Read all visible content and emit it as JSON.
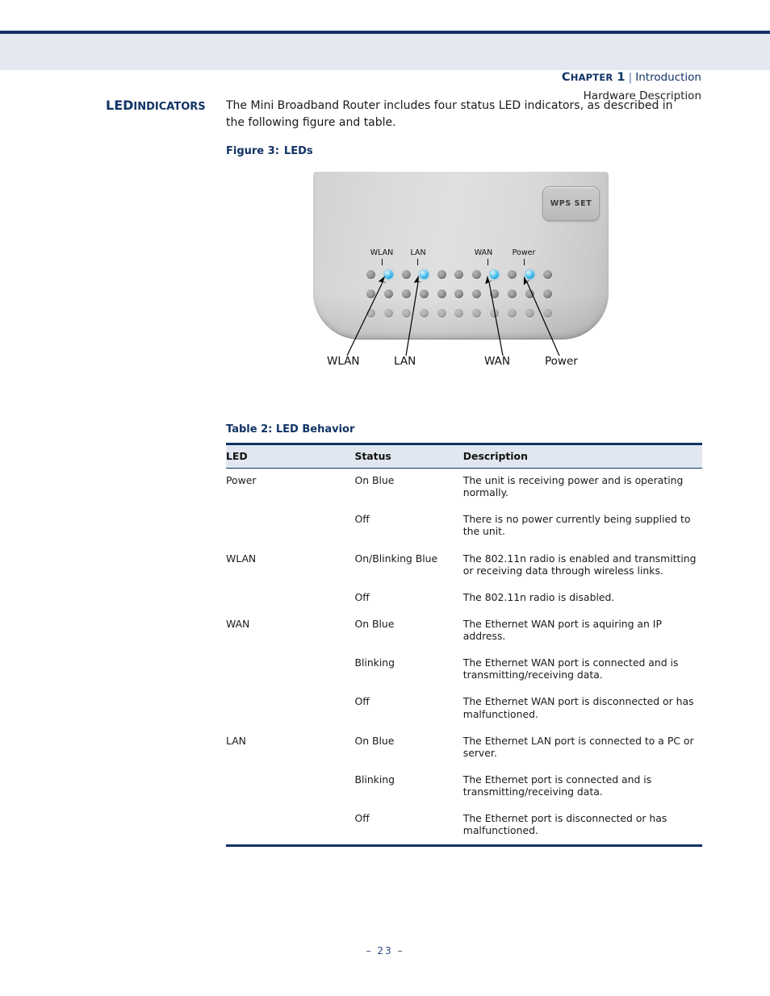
{
  "header": {
    "chapter_label_cap": "C",
    "chapter_label_rest": "HAPTER",
    "chapter_number": "1",
    "separator": "|",
    "chapter_title": "Introduction",
    "subtitle": "Hardware Description",
    "rule_color": "#113366",
    "band_color": "#e4e8f1"
  },
  "section": {
    "heading_big": "LED",
    "heading_small": "INDICATORS",
    "body": "The Mini Broadband Router includes four status LED indicators, as described in the following figure and table."
  },
  "figure": {
    "caption_number": "Figure 3:",
    "caption_title": "LEDs",
    "wps_button_label": "WPS SET",
    "led_top_labels": [
      "WLAN",
      "LAN",
      "WAN",
      "Power"
    ],
    "callout_labels": [
      "WLAN",
      "LAN",
      "WAN",
      "Power"
    ],
    "led_rows": [
      [
        "off",
        "on",
        "off",
        "on",
        "off",
        "off",
        "off",
        "on",
        "off",
        "on",
        "off"
      ],
      [
        "off",
        "off",
        "off",
        "off",
        "off",
        "off",
        "off",
        "off",
        "off",
        "off",
        "off"
      ],
      [
        "dim",
        "dim",
        "dim",
        "dim",
        "dim",
        "dim",
        "dim",
        "dim",
        "dim",
        "dim",
        "dim"
      ]
    ],
    "led_on_color": "#35b6ea",
    "device_color": "#d9d9d9"
  },
  "table": {
    "caption_number": "Table 2:",
    "caption_title": "LED Behavior",
    "columns": [
      "LED",
      "Status",
      "Description"
    ],
    "rows": [
      {
        "led": "Power",
        "status": "On Blue",
        "description": "The unit is receiving power and is operating normally.",
        "spacer": false
      },
      {
        "led": "",
        "status": "Off",
        "description": "There is no power currently being supplied to the unit.",
        "spacer": true
      },
      {
        "led": "WLAN",
        "status": "On/Blinking Blue",
        "description": "The 802.11n radio is enabled and transmitting or receiving data through wireless links.",
        "spacer": true
      },
      {
        "led": "",
        "status": "Off",
        "description": "The 802.11n radio is disabled.",
        "spacer": true
      },
      {
        "led": "WAN",
        "status": "On Blue",
        "description": "The Ethernet WAN port is aquiring an IP address.",
        "spacer": false
      },
      {
        "led": "",
        "status": "Blinking",
        "description": "The Ethernet WAN port is connected and is transmitting/receiving data.",
        "spacer": true
      },
      {
        "led": "",
        "status": "Off",
        "description": "The Ethernet WAN port is disconnected or has malfunctioned.",
        "spacer": true
      },
      {
        "led": "LAN",
        "status": "On Blue",
        "description": "The Ethernet LAN port is connected to a PC or server.",
        "spacer": true
      },
      {
        "led": "",
        "status": "Blinking",
        "description": "The Ethernet port is connected and is transmitting/receiving data.",
        "spacer": true
      },
      {
        "led": "",
        "status": "Off",
        "description": "The Ethernet port is disconnected or has malfunctioned.",
        "spacer": true
      }
    ]
  },
  "footer": {
    "page_marker": "–  23  –"
  }
}
